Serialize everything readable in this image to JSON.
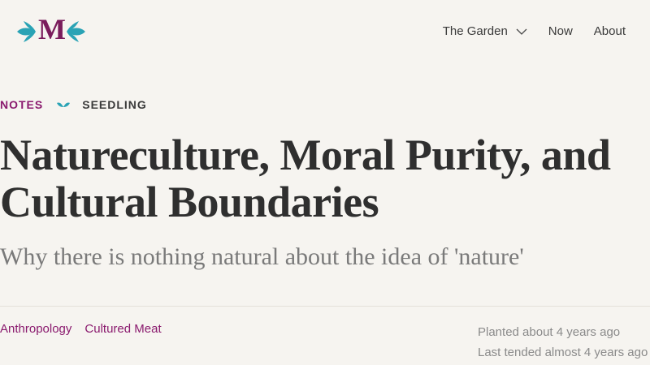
{
  "header": {
    "logo_letter": "M",
    "nav": {
      "garden_label": "The Garden",
      "now_label": "Now",
      "about_label": "About"
    }
  },
  "article": {
    "category": "NOTES",
    "stage": "SEEDLING",
    "title": "Natureculture, Moral Purity, and Cultural Boundaries",
    "subtitle": "Why there is nothing natural about the idea of 'nature'",
    "tags": [
      "Anthropology",
      "Cultured Meat"
    ],
    "planted": "Planted about 4 years ago",
    "tended": "Last tended almost 4 years ago"
  },
  "colors": {
    "background": "#f6f4f0",
    "accent_purple": "#8a1a6e",
    "accent_teal": "#2aa3b5",
    "text_dark": "#2f2f2f",
    "text_muted": "#8a8a8a"
  },
  "icons": {
    "logo_leaves": "leaf-icon",
    "nav_chevron": "chevron-down-icon",
    "stage_icon": "seedling-icon"
  }
}
